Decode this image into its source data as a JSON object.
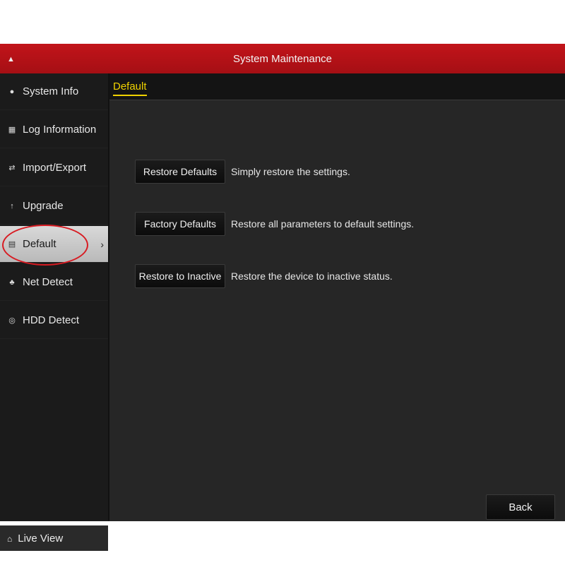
{
  "window": {
    "title": "System Maintenance"
  },
  "sidebar": {
    "items": [
      {
        "label": "System Info",
        "icon": "info-circle-icon"
      },
      {
        "label": "Log Information",
        "icon": "log-icon"
      },
      {
        "label": "Import/Export",
        "icon": "import-export-icon"
      },
      {
        "label": "Upgrade",
        "icon": "upgrade-arrow-icon"
      },
      {
        "label": "Default",
        "icon": "default-icon",
        "active": true
      },
      {
        "label": "Net Detect",
        "icon": "network-icon"
      },
      {
        "label": "HDD Detect",
        "icon": "hdd-icon"
      }
    ],
    "live_view": "Live View"
  },
  "main": {
    "tab": "Default",
    "actions": [
      {
        "button": "Restore Defaults",
        "description": "Simply restore the settings."
      },
      {
        "button": "Factory Defaults",
        "description": "Restore all parameters to default settings."
      },
      {
        "button": "Restore to Inactive",
        "description": "Restore the device to inactive status."
      }
    ],
    "back_label": "Back"
  },
  "colors": {
    "title_bar": "#b3121a",
    "tab_accent": "#f0d200",
    "annotation_circle": "#d81b22"
  }
}
